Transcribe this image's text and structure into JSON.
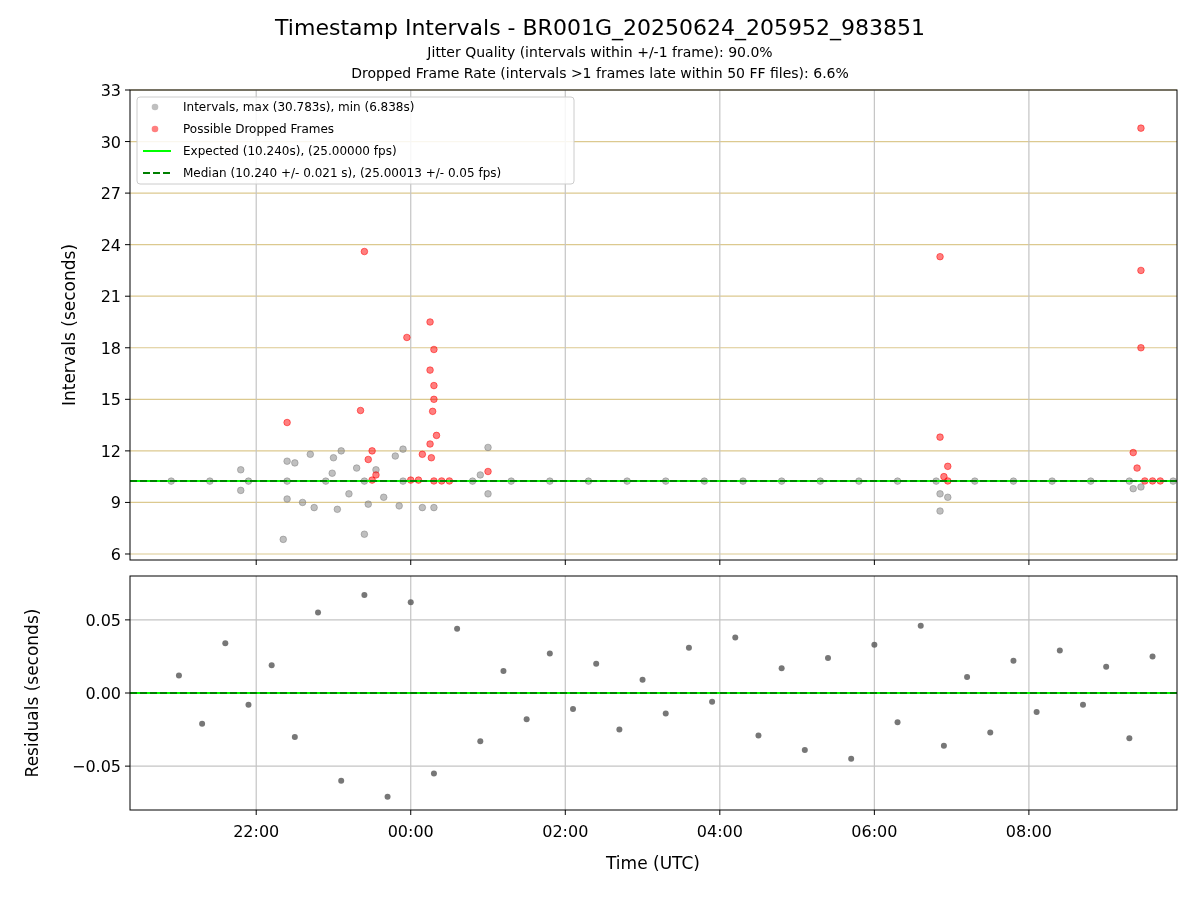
{
  "title": "Timestamp Intervals - BR001G_20250624_205952_983851",
  "subtitles": [
    "Jitter Quality (intervals within +/-1 frame): 90.0%",
    "Dropped Frame Rate (intervals >1 frames late within 50 FF files): 6.6%"
  ],
  "top": {
    "chart_data": {
      "type": "scatter",
      "ylabel": "Intervals (seconds)",
      "grid": true,
      "xlim": [
        "2025-06-24T20:22",
        "2025-06-25T09:55"
      ],
      "ylim": [
        5.65,
        33
      ],
      "yticks": [
        {
          "value": 6,
          "label": "6"
        },
        {
          "value": 9,
          "label": "9"
        },
        {
          "value": 12,
          "label": "12"
        },
        {
          "value": 15,
          "label": "15"
        },
        {
          "value": 18,
          "label": "18"
        },
        {
          "value": 21,
          "label": "21"
        },
        {
          "value": 24,
          "label": "24"
        },
        {
          "value": 27,
          "label": "27"
        },
        {
          "value": 30,
          "label": "30"
        },
        {
          "value": 33,
          "label": "33"
        }
      ],
      "series": [
        {
          "name": "Intervals, max (30.783s), min (6.838s)",
          "color": "#808080",
          "x": [
            "2025-06-24T20:54",
            "2025-06-24T21:24",
            "2025-06-24T21:54",
            "2025-06-24T22:24",
            "2025-06-24T22:54",
            "2025-06-24T23:24",
            "2025-06-24T23:54",
            "2025-06-25T00:48",
            "2025-06-25T01:18",
            "2025-06-25T01:48",
            "2025-06-25T02:18",
            "2025-06-25T02:48",
            "2025-06-25T03:18",
            "2025-06-25T03:48",
            "2025-06-25T04:18",
            "2025-06-25T04:48",
            "2025-06-25T05:18",
            "2025-06-25T05:48",
            "2025-06-25T06:18",
            "2025-06-25T06:48",
            "2025-06-25T07:18",
            "2025-06-25T07:48",
            "2025-06-25T08:18",
            "2025-06-25T08:48",
            "2025-06-25T09:18",
            "2025-06-25T09:52",
            "2025-06-24T22:24",
            "2025-06-24T22:24",
            "2025-06-24T22:21",
            "2025-06-24T22:30",
            "2025-06-24T22:36",
            "2025-06-24T22:42",
            "2025-06-24T22:45",
            "2025-06-24T22:59",
            "2025-06-24T23:00",
            "2025-06-24T23:03",
            "2025-06-24T23:06",
            "2025-06-24T23:12",
            "2025-06-24T23:18",
            "2025-06-24T23:24",
            "2025-06-24T23:27",
            "2025-06-24T23:33",
            "2025-06-24T23:39",
            "2025-06-24T23:48",
            "2025-06-24T23:54",
            "2025-06-24T23:51",
            "2025-06-25T00:09",
            "2025-06-25T00:18",
            "2025-06-25T01:00",
            "2025-06-25T01:00",
            "2025-06-25T00:54",
            "2025-06-24T21:48",
            "2025-06-24T21:48",
            "2025-06-25T06:51",
            "2025-06-25T06:51",
            "2025-06-25T06:57",
            "2025-06-25T09:21",
            "2025-06-25T09:27"
          ],
          "values": [
            10.24,
            10.24,
            10.24,
            10.24,
            10.24,
            10.24,
            10.24,
            10.24,
            10.24,
            10.24,
            10.24,
            10.24,
            10.24,
            10.24,
            10.24,
            10.24,
            10.24,
            10.24,
            10.24,
            10.24,
            10.24,
            10.24,
            10.24,
            10.24,
            10.24,
            10.24,
            11.4,
            9.2,
            6.85,
            11.3,
            9.0,
            11.8,
            8.7,
            10.7,
            11.6,
            8.6,
            12.0,
            9.5,
            11.0,
            7.15,
            8.9,
            10.9,
            9.3,
            11.7,
            12.1,
            8.8,
            8.7,
            8.7,
            12.2,
            9.5,
            10.6,
            10.9,
            9.7,
            8.5,
            9.5,
            9.3,
            9.8,
            9.9
          ]
        },
        {
          "name": "Possible Dropped Frames",
          "color": "#ff0000",
          "x": [
            "2025-06-24T23:24",
            "2025-06-24T22:24",
            "2025-06-24T23:21",
            "2025-06-24T23:57",
            "2025-06-25T00:15",
            "2025-06-25T00:18",
            "2025-06-25T00:15",
            "2025-06-25T00:18",
            "2025-06-25T00:18",
            "2025-06-25T00:17",
            "2025-06-25T00:20",
            "2025-06-25T00:15",
            "2025-06-25T00:16",
            "2025-06-24T23:30",
            "2025-06-24T23:27",
            "2025-06-24T23:33",
            "2025-06-25T00:09",
            "2025-06-25T01:00",
            "2025-06-25T00:00",
            "2025-06-25T00:06",
            "2025-06-25T00:18",
            "2025-06-25T00:24",
            "2025-06-25T00:30",
            "2025-06-24T23:30",
            "2025-06-25T06:51",
            "2025-06-25T06:51",
            "2025-06-25T06:57",
            "2025-06-25T06:54",
            "2025-06-25T06:57",
            "2025-06-25T09:27",
            "2025-06-25T09:27",
            "2025-06-25T09:27",
            "2025-06-25T09:21",
            "2025-06-25T09:24",
            "2025-06-25T09:30",
            "2025-06-25T09:36",
            "2025-06-25T09:42"
          ],
          "values": [
            23.6,
            13.65,
            14.35,
            18.6,
            19.5,
            17.9,
            16.7,
            15.8,
            15.0,
            14.3,
            12.9,
            12.4,
            11.6,
            12.0,
            11.5,
            10.6,
            11.8,
            10.8,
            10.3,
            10.3,
            10.25,
            10.25,
            10.25,
            10.3,
            23.3,
            12.8,
            11.1,
            10.5,
            10.25,
            30.78,
            22.5,
            18.0,
            11.9,
            11.0,
            10.25,
            10.25,
            10.25
          ]
        }
      ],
      "ref_lines": [
        {
          "axis": "y",
          "value": 10.24,
          "label": "Expected (10.240s), (25.00000 fps)",
          "color": "#00ff00"
        },
        {
          "axis": "y",
          "value": 10.24,
          "label": "Median (10.240 +/- 0.021 s), (25.00013 +/- 0.05 fps)",
          "color": "#008000"
        }
      ],
      "legend": "upper left"
    }
  },
  "bottom": {
    "chart_data": {
      "type": "scatter",
      "xlabel": "Time (UTC)",
      "ylabel": "Residuals (seconds)",
      "grid": true,
      "xlim": [
        "2025-06-24T20:22",
        "2025-06-25T09:55"
      ],
      "ylim": [
        -0.08,
        0.08
      ],
      "xticks": [
        {
          "value": "2025-06-24T22:00",
          "label": "22:00"
        },
        {
          "value": "2025-06-25T00:00",
          "label": "00:00"
        },
        {
          "value": "2025-06-25T02:00",
          "label": "02:00"
        },
        {
          "value": "2025-06-25T04:00",
          "label": "04:00"
        },
        {
          "value": "2025-06-25T06:00",
          "label": "06:00"
        },
        {
          "value": "2025-06-25T08:00",
          "label": "08:00"
        }
      ],
      "yticks": [
        {
          "value": -0.05,
          "label": "−0.05"
        },
        {
          "value": 0,
          "label": "0.00"
        },
        {
          "value": 0.05,
          "label": "0.05"
        }
      ],
      "series": [
        {
          "color": "#555555",
          "x": [
            "2025-06-24T21:00",
            "2025-06-24T21:18",
            "2025-06-24T21:36",
            "2025-06-24T21:54",
            "2025-06-24T22:12",
            "2025-06-24T22:30",
            "2025-06-24T22:48",
            "2025-06-24T23:06",
            "2025-06-24T23:24",
            "2025-06-24T23:42",
            "2025-06-25T00:00",
            "2025-06-25T00:18",
            "2025-06-25T00:36",
            "2025-06-25T00:54",
            "2025-06-25T01:12",
            "2025-06-25T01:30",
            "2025-06-25T01:48",
            "2025-06-25T02:06",
            "2025-06-25T02:24",
            "2025-06-25T02:42",
            "2025-06-25T03:00",
            "2025-06-25T03:18",
            "2025-06-25T03:36",
            "2025-06-25T03:54",
            "2025-06-25T04:12",
            "2025-06-25T04:30",
            "2025-06-25T04:48",
            "2025-06-25T05:06",
            "2025-06-25T05:24",
            "2025-06-25T05:42",
            "2025-06-25T06:00",
            "2025-06-25T06:18",
            "2025-06-25T06:36",
            "2025-06-25T06:54",
            "2025-06-25T07:12",
            "2025-06-25T07:30",
            "2025-06-25T07:48",
            "2025-06-25T08:06",
            "2025-06-25T08:24",
            "2025-06-25T08:42",
            "2025-06-25T09:00",
            "2025-06-25T09:18",
            "2025-06-25T09:36"
          ],
          "values": [
            0.012,
            -0.021,
            0.034,
            -0.008,
            0.019,
            -0.03,
            0.055,
            -0.06,
            0.067,
            -0.071,
            0.062,
            -0.055,
            0.044,
            -0.033,
            0.015,
            -0.018,
            0.027,
            -0.011,
            0.02,
            -0.025,
            0.009,
            -0.014,
            0.031,
            -0.006,
            0.038,
            -0.029,
            0.017,
            -0.039,
            0.024,
            -0.045,
            0.033,
            -0.02,
            0.046,
            -0.036,
            0.011,
            -0.027,
            0.022,
            -0.013,
            0.029,
            -0.008,
            0.018,
            -0.031,
            0.025
          ]
        }
      ],
      "ref_lines": [
        {
          "axis": "y",
          "value": 0,
          "color": "#00ff00"
        },
        {
          "axis": "y",
          "value": 0,
          "color": "#008000"
        }
      ]
    }
  }
}
